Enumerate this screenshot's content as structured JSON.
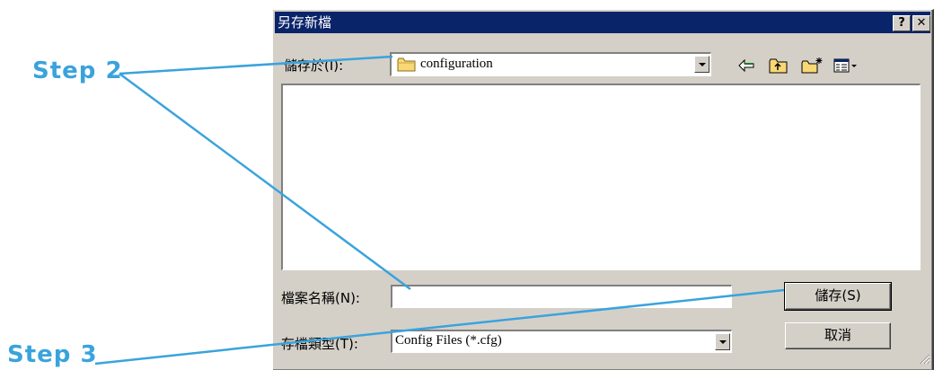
{
  "annotations": {
    "step2": "Step 2",
    "step3": "Step 3",
    "line_color": "#3aa3dc"
  },
  "dialog": {
    "title": "另存新檔",
    "help_button": "?",
    "close_button": "✕",
    "save_in_label": "儲存於(I):",
    "save_in_value": "configuration",
    "toolbar_icons": [
      "back-icon",
      "up-folder-icon",
      "new-folder-icon",
      "view-menu-icon"
    ],
    "file_name_label": "檔案名稱(N):",
    "file_name_value": "",
    "file_type_label": "存檔類型(T):",
    "file_type_value": "Config Files (*.cfg)",
    "save_button": "儲存(S)",
    "cancel_button": "取消"
  },
  "colors": {
    "titlebar": "#0a246a",
    "dialog_bg": "#d4d0c8",
    "folder": "#f8d775"
  }
}
